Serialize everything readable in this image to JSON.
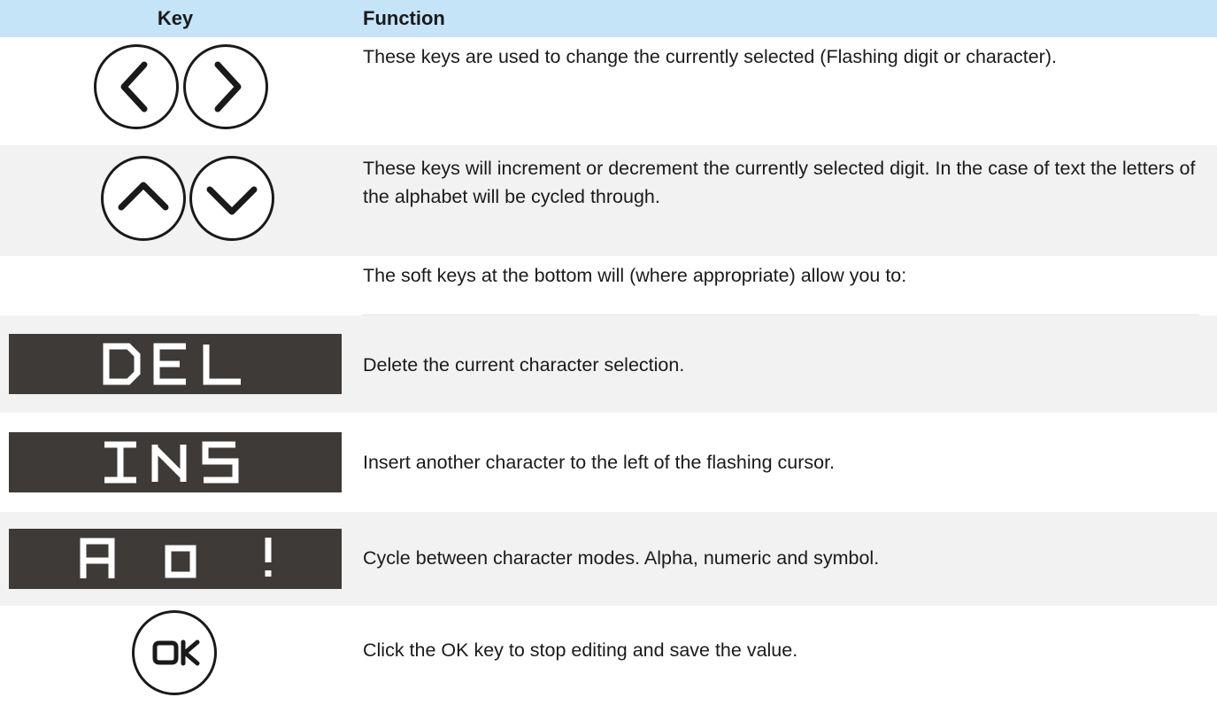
{
  "table": {
    "header": {
      "key_label": "Key",
      "function_label": "Function"
    },
    "rows": [
      {
        "key": {
          "type": "circle-pair",
          "icons": [
            "chevron-left-icon",
            "chevron-right-icon"
          ]
        },
        "function": "These keys are used to change the currently selected (Flashing digit or character)."
      },
      {
        "key": {
          "type": "circle-pair",
          "icons": [
            "chevron-up-icon",
            "chevron-down-icon"
          ]
        },
        "function": "These keys will increment or decrement the currently selected digit. In the case of text the letters of the alphabet will be cycled through."
      },
      {
        "key": {
          "type": "none"
        },
        "function": "The soft keys at the bottom will (where appropriate) allow you to:"
      },
      {
        "key": {
          "type": "softkey",
          "label": "DEL"
        },
        "function": "Delete the current character selection."
      },
      {
        "key": {
          "type": "softkey",
          "label": "INS"
        },
        "function": "Insert another character to the left of the flashing cursor."
      },
      {
        "key": {
          "type": "softkey",
          "label": "A 0 !"
        },
        "function": "Cycle between character modes. Alpha, numeric and symbol."
      },
      {
        "key": {
          "type": "circle",
          "label": "OK"
        },
        "function": "Click the OK key to stop editing and save the value."
      }
    ]
  },
  "colors": {
    "header_bg": "#c5e4f8",
    "row_shade": "#f2f2f2",
    "softkey_bg": "#3d3a37",
    "softkey_text": "#ffffff",
    "key_stroke": "#1a1a1a"
  }
}
